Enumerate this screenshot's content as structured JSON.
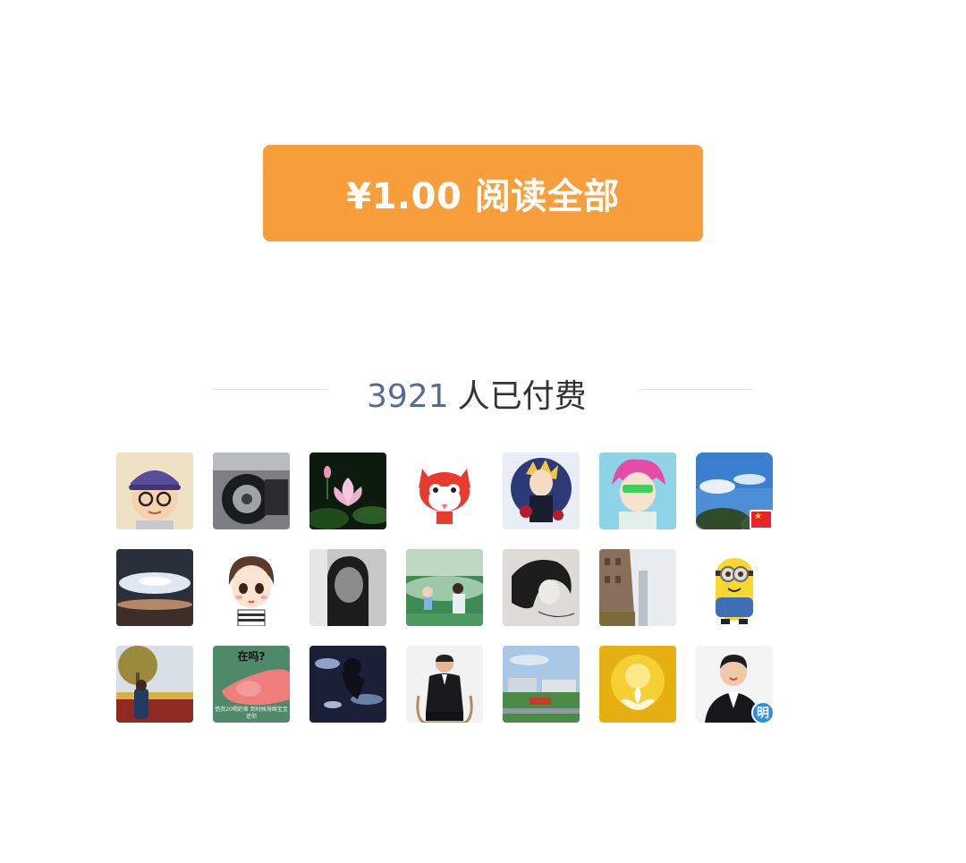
{
  "pay_button": {
    "label": "¥1.00 阅读全部"
  },
  "paid": {
    "count": "3921",
    "suffix": "人已付费"
  },
  "avatars": [
    {
      "name": "cartoon-glasses-boy"
    },
    {
      "name": "motorcycle-wheel"
    },
    {
      "name": "lotus-flower"
    },
    {
      "name": "red-fox-cartoon"
    },
    {
      "name": "anime-blonde-boy"
    },
    {
      "name": "anime-pink-hair"
    },
    {
      "name": "blue-sky-flag",
      "flag": "★"
    },
    {
      "name": "sunset-clouds"
    },
    {
      "name": "cartoon-short-hair-girl"
    },
    {
      "name": "black-white-portrait"
    },
    {
      "name": "child-on-grass"
    },
    {
      "name": "sketch-woman"
    },
    {
      "name": "building-street"
    },
    {
      "name": "minion-cartoon"
    },
    {
      "name": "person-by-tree"
    },
    {
      "name": "meme-hand",
      "top_text": "在吗?",
      "bottom_text": "借我20喝奶茶 到时候海绵宝宝还你"
    },
    {
      "name": "dark-water-figure"
    },
    {
      "name": "man-in-suit-chair"
    },
    {
      "name": "industrial-park"
    },
    {
      "name": "golden-lotus"
    },
    {
      "name": "smiling-man-suit",
      "badge": "明"
    }
  ]
}
